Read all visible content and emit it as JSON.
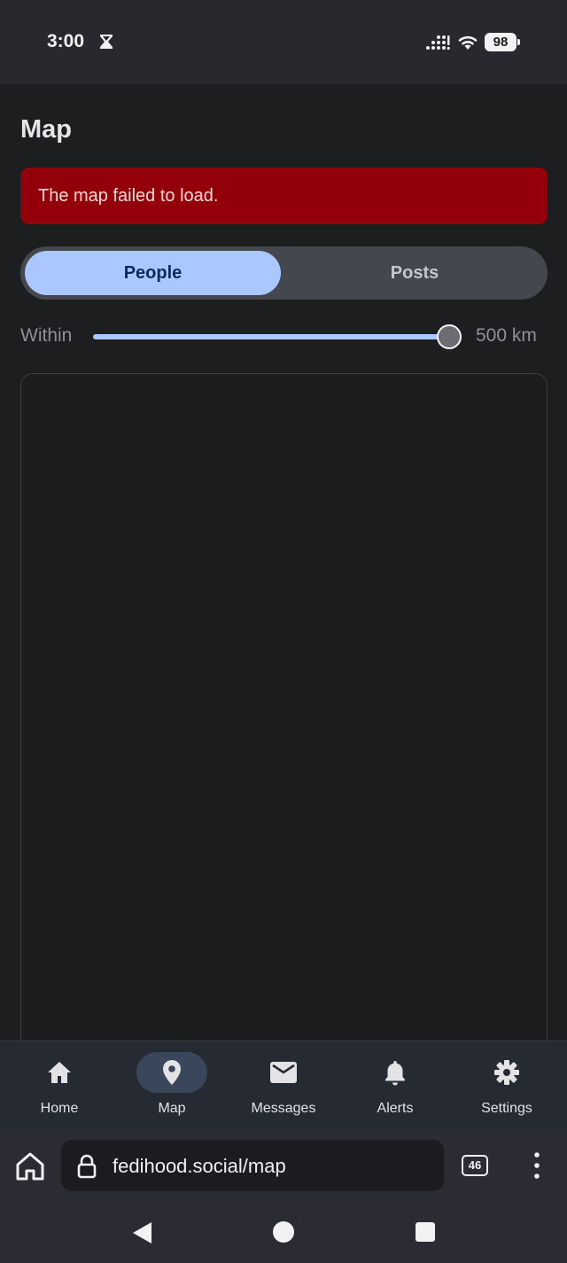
{
  "status_bar": {
    "time": "3:00",
    "battery": "98"
  },
  "page": {
    "title": "Map",
    "error": "The map failed to load."
  },
  "toggle": {
    "options": [
      "People",
      "Posts"
    ],
    "selected": "People"
  },
  "radius": {
    "label": "Within",
    "value_text": "500 km",
    "fraction": 1.0
  },
  "bottom_nav": {
    "items": [
      {
        "label": "Home",
        "icon": "home-icon"
      },
      {
        "label": "Map",
        "icon": "map-pin-icon"
      },
      {
        "label": "Messages",
        "icon": "mail-icon"
      },
      {
        "label": "Alerts",
        "icon": "bell-icon"
      },
      {
        "label": "Settings",
        "icon": "gear-icon"
      }
    ],
    "active": "Map"
  },
  "browser": {
    "url": "fedihood.social/map",
    "tab_count": "46"
  },
  "colors": {
    "error_bg": "#93000a",
    "accent": "#aac7ff",
    "background": "#1d1e20"
  }
}
